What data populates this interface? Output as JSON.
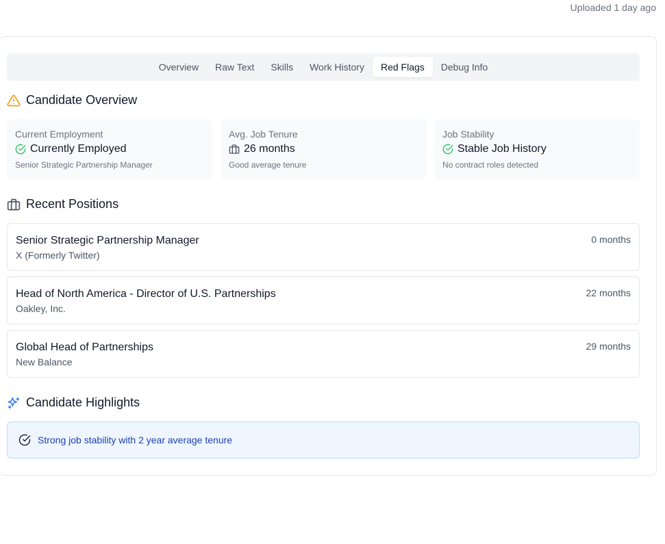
{
  "header": {
    "uploaded": "Uploaded 1 day ago"
  },
  "tabs": [
    {
      "label": "Overview"
    },
    {
      "label": "Raw Text"
    },
    {
      "label": "Skills"
    },
    {
      "label": "Work History"
    },
    {
      "label": "Red Flags",
      "active": true
    },
    {
      "label": "Debug Info"
    }
  ],
  "overview": {
    "title": "Candidate Overview",
    "icon": "warning-icon",
    "stats": [
      {
        "label": "Current Employment",
        "icon": "check-circle-icon",
        "value": "Currently Employed",
        "sub": "Senior Strategic Partnership Manager"
      },
      {
        "label": "Avg. Job Tenure",
        "icon": "briefcase-icon",
        "value": "26 months",
        "sub": "Good average tenure"
      },
      {
        "label": "Job Stability",
        "icon": "check-circle-icon",
        "value": "Stable Job History",
        "sub": "No contract roles detected"
      }
    ]
  },
  "recent": {
    "title": "Recent Positions",
    "icon": "briefcase-icon",
    "positions": [
      {
        "title": "Senior Strategic Partnership Manager",
        "company": "X (Formerly Twitter)",
        "duration": "0 months"
      },
      {
        "title": "Head of North America - Director of U.S. Partnerships",
        "company": "Oakley, Inc.",
        "duration": "22 months"
      },
      {
        "title": "Global Head of Partnerships",
        "company": "New Balance",
        "duration": "29 months"
      }
    ]
  },
  "highlights": {
    "title": "Candidate Highlights",
    "icon": "sparkles-icon",
    "items": [
      {
        "icon": "check-circle-icon",
        "text": "Strong job stability with 2 year average tenure"
      }
    ]
  },
  "colors": {
    "warning": "#f59e0b",
    "success": "#22c55e",
    "highlight_bg": "#eff6ff",
    "highlight_text": "#1e40af",
    "sparkle": "#3b82f6"
  }
}
